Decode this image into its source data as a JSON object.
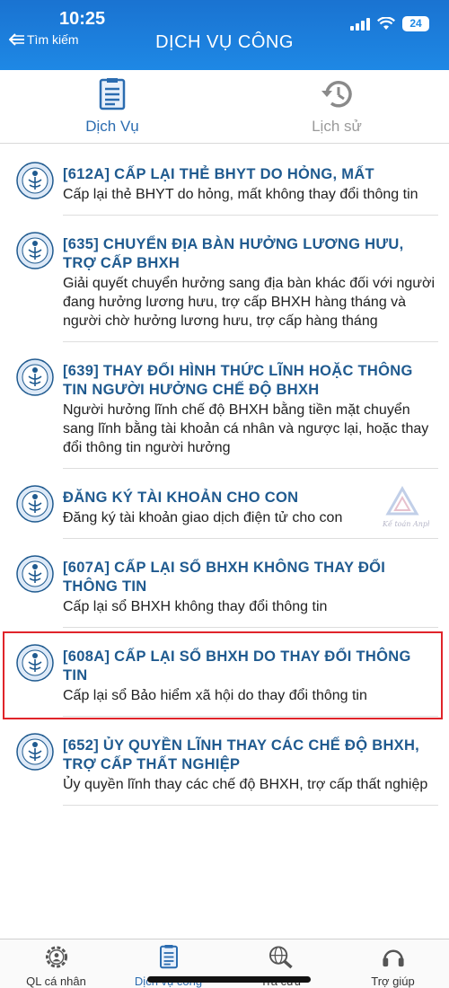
{
  "status_bar": {
    "time": "10:25",
    "battery": "24"
  },
  "header": {
    "back_label": "Tìm kiếm",
    "title": "DỊCH VỤ CÔNG"
  },
  "top_tabs": [
    {
      "label": "Dịch Vụ",
      "icon": "document-list-icon",
      "active": true
    },
    {
      "label": "Lịch sử",
      "icon": "history-icon",
      "active": false
    }
  ],
  "services": [
    {
      "title": "[612A] CẤP LẠI THẺ BHYT DO HỎNG, MẤT",
      "desc": "Cấp lại thẻ BHYT do hỏng, mất không thay đổi thông tin"
    },
    {
      "title": "[635] CHUYỂN ĐỊA BÀN HƯỞNG LƯƠNG HƯU, TRỢ CẤP BHXH",
      "desc": "Giải quyết chuyển hưởng sang địa bàn khác đối với người đang hưởng lương hưu, trợ cấp BHXH hàng tháng và người chờ hưởng lương hưu, trợ cấp hàng tháng"
    },
    {
      "title": "[639] THAY ĐỔI HÌNH THỨC LĨNH HOẶC THÔNG TIN NGƯỜI HƯỞNG CHẾ ĐỘ BHXH",
      "desc": "Người hưởng lĩnh chế độ BHXH bằng tiền mặt chuyển sang lĩnh bằng tài khoản cá nhân và ngược lại, hoặc thay đổi thông tin người hưởng"
    },
    {
      "title": "ĐĂNG KÝ TÀI KHOẢN CHO CON",
      "desc": "Đăng ký tài khoản giao dịch điện tử cho con"
    },
    {
      "title": "[607A] CẤP LẠI SỔ BHXH KHÔNG THAY ĐỔI THÔNG TIN",
      "desc": "Cấp lại sổ BHXH không thay đổi thông tin"
    },
    {
      "title": "[608A] CẤP LẠI SỔ BHXH DO THAY ĐỔI THÔNG TIN",
      "desc": "Cấp lại sổ Bảo hiểm xã hội do thay đổi thông tin"
    },
    {
      "title": "[652] ỦY QUYỀN LĨNH THAY CÁC CHẾ ĐỘ BHXH, TRỢ CẤP THẤT NGHIỆP",
      "desc": "Ủy quyền lĩnh thay các chế độ BHXH, trợ cấp thất nghiệp"
    }
  ],
  "watermark": {
    "text": "Kế toán Anpha"
  },
  "bottom_nav": [
    {
      "label": "QL cá nhân",
      "icon": "gear-person-icon",
      "active": false
    },
    {
      "label": "Dịch vụ công",
      "icon": "document-list-icon",
      "active": true
    },
    {
      "label": "Tra cứu",
      "icon": "globe-search-icon",
      "active": false
    },
    {
      "label": "Trợ giúp",
      "icon": "headset-icon",
      "active": false
    }
  ],
  "colors": {
    "header_blue": "#1e88e5",
    "title_blue": "#1f5a8f",
    "highlight_red": "#e0242a"
  }
}
